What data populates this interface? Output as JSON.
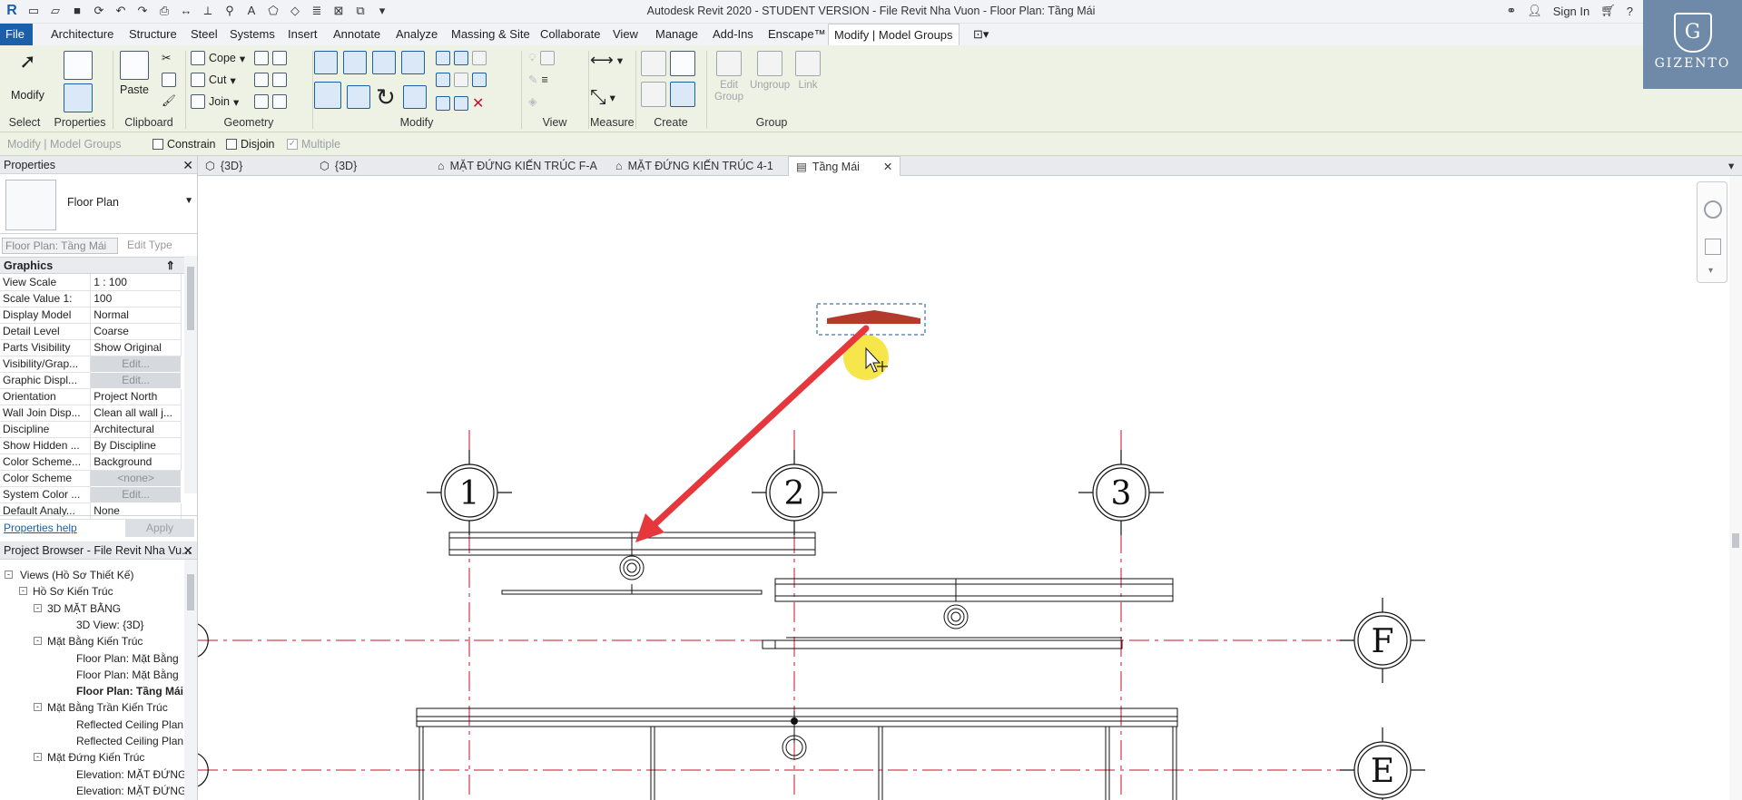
{
  "app": {
    "title": "Autodesk Revit 2020 - STUDENT VERSION - File Revit Nha Vuon - Floor Plan: Tầng Mái",
    "sign_in": "Sign In"
  },
  "menu": {
    "tabs": [
      "File",
      "Architecture",
      "Structure",
      "Steel",
      "Systems",
      "Insert",
      "Annotate",
      "Analyze",
      "Massing & Site",
      "Collaborate",
      "View",
      "Manage",
      "Add-Ins",
      "Enscape™",
      "Modify | Model Groups"
    ]
  },
  "ribbon": {
    "modify_label": "Modify",
    "paste_label": "Paste",
    "cope_label": "Cope",
    "cut_label": "Cut",
    "join_label": "Join",
    "edit_group_label": "Edit\nGroup",
    "ungroup_label": "Ungroup",
    "link_label": "Link",
    "groups": {
      "select": "Select",
      "properties": "Properties",
      "clipboard": "Clipboard",
      "geometry": "Geometry",
      "modify": "Modify",
      "view": "View",
      "measure": "Measure",
      "create": "Create",
      "group": "Group"
    }
  },
  "optionsbar": {
    "context": "Modify | Model Groups",
    "constrain": "Constrain",
    "disjoin": "Disjoin",
    "multiple": "Multiple"
  },
  "brand": {
    "initial": "G",
    "name": "GIZENTO"
  },
  "properties": {
    "header": "Properties",
    "type_name": "Floor Plan",
    "instance_selector": "Floor Plan: Tầng Mái",
    "edit_type": "Edit Type",
    "section": "Graphics",
    "rows": [
      {
        "key": "View Scale",
        "value": "1 : 100"
      },
      {
        "key": "Scale Value    1:",
        "value": "100"
      },
      {
        "key": "Display Model",
        "value": "Normal"
      },
      {
        "key": "Detail Level",
        "value": "Coarse"
      },
      {
        "key": "Parts Visibility",
        "value": "Show Original"
      },
      {
        "key": "Visibility/Grap...",
        "value": "Edit..."
      },
      {
        "key": "Graphic Displ...",
        "value": "Edit..."
      },
      {
        "key": "Orientation",
        "value": "Project North"
      },
      {
        "key": "Wall Join Disp...",
        "value": "Clean all wall j..."
      },
      {
        "key": "Discipline",
        "value": "Architectural"
      },
      {
        "key": "Show Hidden ...",
        "value": "By Discipline"
      },
      {
        "key": "Color Scheme...",
        "value": "Background"
      },
      {
        "key": "Color Scheme",
        "value": "<none>"
      },
      {
        "key": "System Color ...",
        "value": "Edit..."
      },
      {
        "key": "Default Analy...",
        "value": "None"
      }
    ],
    "help_link": "Properties help",
    "apply": "Apply"
  },
  "browser": {
    "header": "Project Browser - File Revit Nha Vu...",
    "nodes": [
      {
        "label": "Views (Hồ Sơ Thiết Kế)",
        "level": 0,
        "expander": "-"
      },
      {
        "label": "Hồ Sơ Kiến Trúc",
        "level": 1,
        "expander": "-"
      },
      {
        "label": "3D MẶT BẰNG",
        "level": 2,
        "expander": "-"
      },
      {
        "label": "3D View: {3D}",
        "level": 3,
        "expander": ""
      },
      {
        "label": "Mặt Bằng Kiến Trúc",
        "level": 2,
        "expander": "-"
      },
      {
        "label": "Floor Plan: Mặt Bằng",
        "level": 3,
        "expander": ""
      },
      {
        "label": "Floor Plan: Mặt Bằng",
        "level": 3,
        "expander": ""
      },
      {
        "label": "Floor Plan: Tầng Mái",
        "level": 3,
        "expander": "",
        "bold": true
      },
      {
        "label": "Mặt Bằng Trần Kiến Trúc",
        "level": 2,
        "expander": "-"
      },
      {
        "label": "Reflected Ceiling Plan",
        "level": 3,
        "expander": ""
      },
      {
        "label": "Reflected Ceiling Plan",
        "level": 3,
        "expander": ""
      },
      {
        "label": "Mặt Đứng Kiến Trúc",
        "level": 2,
        "expander": "-"
      },
      {
        "label": "Elevation: MẶT ĐỨNG",
        "level": 3,
        "expander": ""
      },
      {
        "label": "Elevation: MẶT ĐỨNG",
        "level": 3,
        "expander": ""
      },
      {
        "label": "Elevation: MẶT ĐỨNG",
        "level": 3,
        "expander": ""
      }
    ]
  },
  "view_tabs": [
    {
      "label": "{3D}",
      "icon": "3d-view-icon"
    },
    {
      "label": "{3D}",
      "icon": "3d-view-icon"
    },
    {
      "label": "MẶT ĐỨNG KIẾN TRÚC F-A",
      "icon": "elevation-icon"
    },
    {
      "label": "MẶT ĐỨNG KIẾN TRÚC 4-1",
      "icon": "elevation-icon"
    },
    {
      "label": "Tầng Mái",
      "icon": "floor-plan-icon",
      "active": true
    }
  ],
  "grid_bubbles": {
    "g1": "1",
    "g2": "2",
    "g3": "3",
    "gF": "F",
    "gE": "E"
  },
  "colors": {
    "accent": "#1b5fa8",
    "ribbon_bg": "#eef2e4",
    "grid_line": "#c8102e",
    "arrow": "#e5373c",
    "cursor_highlight": "#f5e22b"
  }
}
